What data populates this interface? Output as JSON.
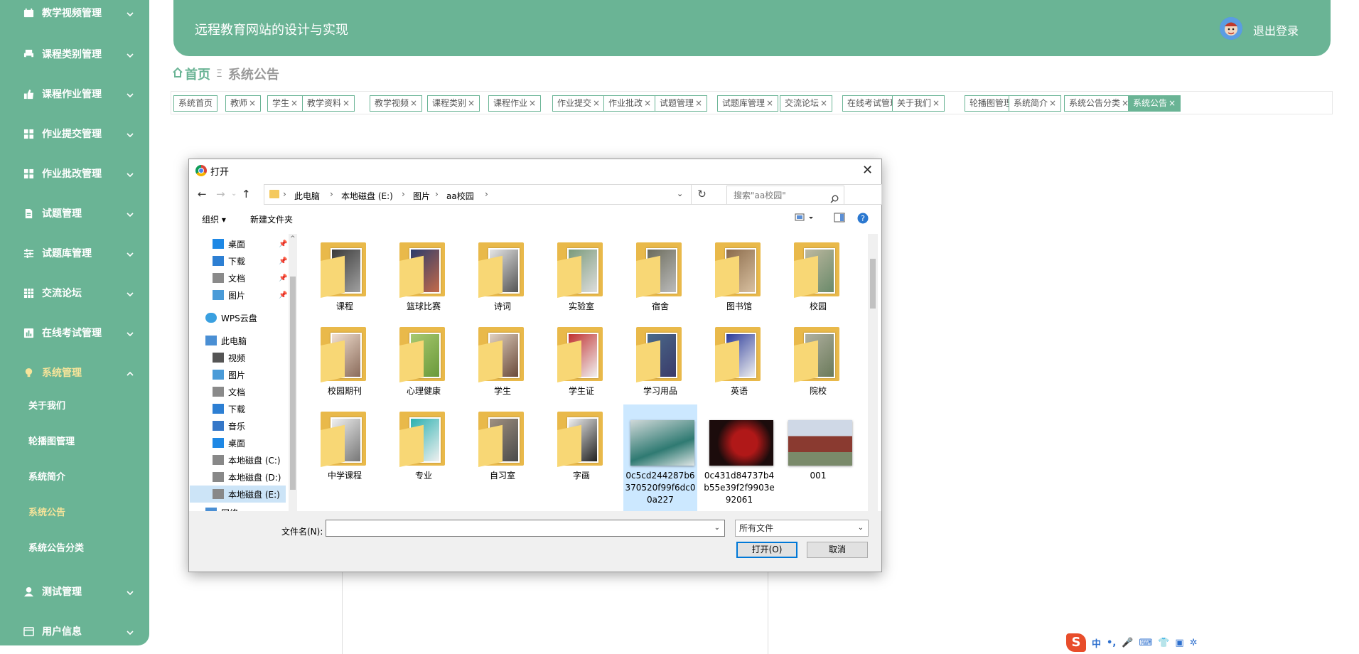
{
  "sidebar": {
    "items": [
      {
        "label": "教学视频管理",
        "top": 0
      },
      {
        "label": "课程类别管理"
      },
      {
        "label": "课程作业管理"
      },
      {
        "label": "作业提交管理"
      },
      {
        "label": "作业批改管理"
      },
      {
        "label": "试题管理"
      },
      {
        "label": "试题库管理"
      },
      {
        "label": "交流论坛"
      },
      {
        "label": "在线考试管理"
      },
      {
        "label": "系统管理"
      },
      {
        "label": "测试管理"
      },
      {
        "label": "用户信息"
      }
    ],
    "sub_items": [
      "关于我们",
      "轮播图管理",
      "系统简介",
      "系统公告",
      "系统公告分类"
    ],
    "active_sub": "系统公告",
    "accent_color": "#6ab495",
    "active_color": "#f7e49a"
  },
  "header": {
    "title": "远程教育网站的设计与实现",
    "logout": "退出登录"
  },
  "breadcrumb": {
    "home": "首页",
    "current": "系统公告"
  },
  "tags": [
    "系统首页",
    "教师",
    "学生",
    "教学资料",
    "教学视频",
    "课程类别",
    "课程作业",
    "作业提交",
    "作业批改",
    "试题管理",
    "试题库管理",
    "交流论坛",
    "在线考试管理",
    "关于我们",
    "轮播图管理",
    "系统简介",
    "系统公告分类",
    "系统公告"
  ],
  "tag_close": "×",
  "dialog": {
    "title": "打开",
    "close": "✕",
    "path": [
      "此电脑",
      "本地磁盘 (E:)",
      "图片",
      "aa校园"
    ],
    "search_placeholder": "搜索\"aa校园\"",
    "organize": "组织 ▾",
    "new_folder": "新建文件夹",
    "nav": [
      {
        "label": "桌面",
        "pin": true,
        "icon": "desktop-icon"
      },
      {
        "label": "下载",
        "pin": true,
        "icon": "download-icon"
      },
      {
        "label": "文档",
        "pin": true,
        "icon": "document-icon"
      },
      {
        "label": "图片",
        "pin": true,
        "icon": "picture-icon"
      },
      {
        "label": "WPS云盘",
        "icon": "cloud-icon"
      },
      {
        "label": "此电脑",
        "icon": "computer-icon"
      },
      {
        "label": "视频",
        "icon": "video-icon"
      },
      {
        "label": "图片",
        "icon": "picture-icon"
      },
      {
        "label": "文档",
        "icon": "document-icon"
      },
      {
        "label": "下载",
        "icon": "download-icon"
      },
      {
        "label": "音乐",
        "icon": "music-icon"
      },
      {
        "label": "桌面",
        "icon": "desktop-icon"
      },
      {
        "label": "本地磁盘 (C:)",
        "icon": "drive-icon"
      },
      {
        "label": "本地磁盘 (D:)",
        "icon": "drive-icon"
      },
      {
        "label": "本地磁盘 (E:)",
        "icon": "drive-icon",
        "selected": true
      },
      {
        "label": "网络",
        "icon": "network-icon"
      }
    ],
    "files": [
      {
        "name": "课程",
        "kind": "folder"
      },
      {
        "name": "篮球比赛",
        "kind": "folder"
      },
      {
        "name": "诗词",
        "kind": "folder"
      },
      {
        "name": "实验室",
        "kind": "folder"
      },
      {
        "name": "宿舍",
        "kind": "folder"
      },
      {
        "name": "图书馆",
        "kind": "folder"
      },
      {
        "name": "校园",
        "kind": "folder"
      },
      {
        "name": "校园期刊",
        "kind": "folder"
      },
      {
        "name": "心理健康",
        "kind": "folder"
      },
      {
        "name": "学生",
        "kind": "folder"
      },
      {
        "name": "学生证",
        "kind": "folder"
      },
      {
        "name": "学习用品",
        "kind": "folder"
      },
      {
        "name": "英语",
        "kind": "folder"
      },
      {
        "name": "院校",
        "kind": "folder"
      },
      {
        "name": "中学课程",
        "kind": "folder"
      },
      {
        "name": "专业",
        "kind": "folder"
      },
      {
        "name": "自习室",
        "kind": "folder"
      },
      {
        "name": "字画",
        "kind": "folder"
      },
      {
        "name": "0c5cd244287b6370520f99f6dc00a227",
        "kind": "image",
        "selected": true
      },
      {
        "name": "0c431d84737b4b55e39f2f9903e92061",
        "kind": "image"
      },
      {
        "name": "001",
        "kind": "image"
      }
    ],
    "filename_label": "文件名(N):",
    "filename_value": "",
    "filetype": "所有文件",
    "open_button": "打开(O)",
    "cancel_button": "取消"
  },
  "ime": {
    "logo": "S",
    "mode": "中"
  }
}
